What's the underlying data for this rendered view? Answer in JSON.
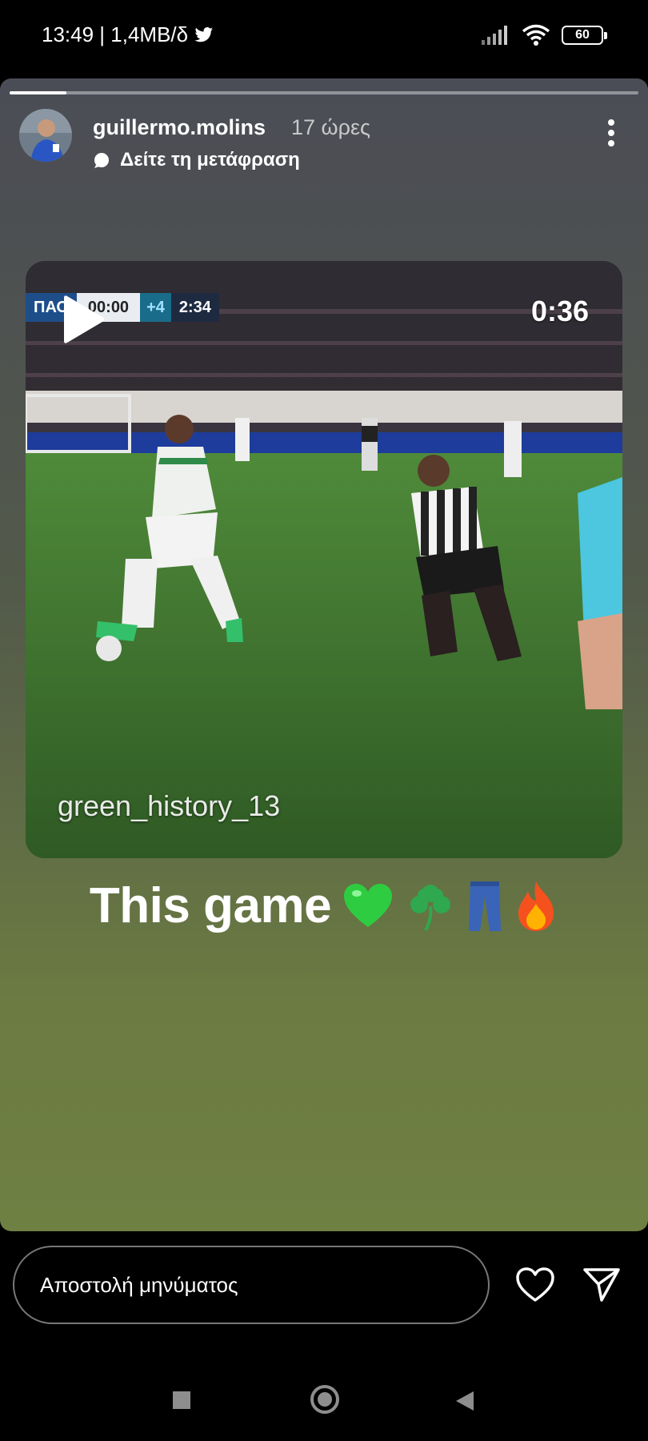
{
  "status_bar": {
    "time_speed": "13:49 | 1,4MB/δ",
    "battery": "60"
  },
  "story": {
    "progress_fraction": 0.09,
    "username": "guillermo.molins",
    "time_ago": "17 ώρες",
    "translate_label": "Δείτε τη μετάφραση",
    "video": {
      "scoreboard_team": "ΠΑΟ",
      "scoreboard_score": "00:00",
      "scoreboard_added": "+4",
      "scoreboard_clock": "2:34",
      "duration": "0:36",
      "watermark": "green_history_13"
    },
    "caption": "This game",
    "caption_emojis": [
      "green-heart",
      "shamrock",
      "jeans",
      "fire"
    ]
  },
  "reply": {
    "placeholder": "Αποστολή μηνύματος"
  }
}
